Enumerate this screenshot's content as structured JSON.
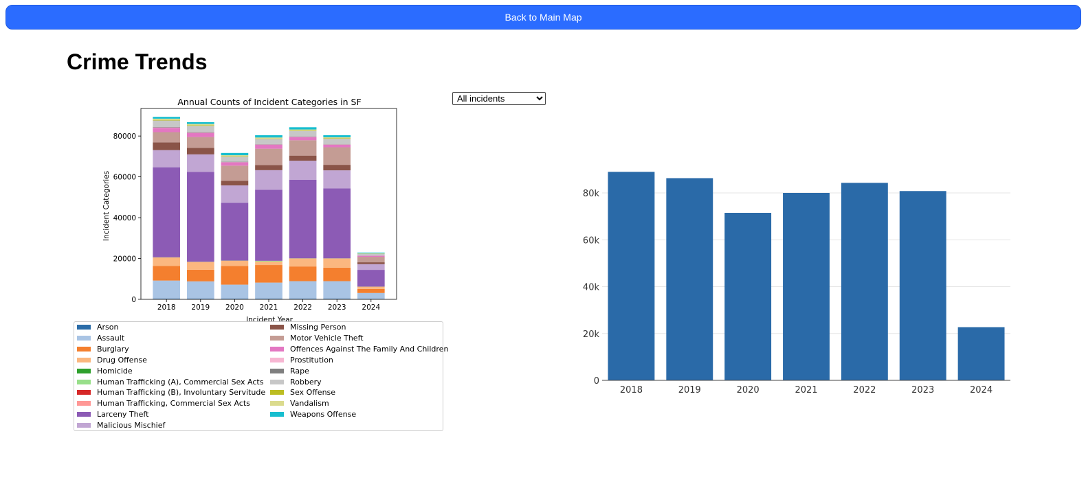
{
  "nav": {
    "back_label": "Back to Main Map"
  },
  "page": {
    "title": "Crime Trends"
  },
  "filter": {
    "selected": "All incidents",
    "options": [
      "All incidents"
    ]
  },
  "chart_data": [
    {
      "type": "bar",
      "stacked": true,
      "title": "Annual Counts of Incident Categories in SF",
      "xlabel": "Incident Year",
      "ylabel": "Incident Categories",
      "ylim": [
        0,
        93500
      ],
      "yticks": [
        0,
        20000,
        40000,
        60000,
        80000
      ],
      "grid": false,
      "legend_position": "below",
      "categories": [
        "2018",
        "2019",
        "2020",
        "2021",
        "2022",
        "2023",
        "2024"
      ],
      "series": [
        {
          "name": "Arson",
          "color": "#2b6ca8",
          "values": [
            300,
            300,
            300,
            300,
            300,
            300,
            100
          ]
        },
        {
          "name": "Assault",
          "color": "#a9c4e4",
          "values": [
            8900,
            8500,
            6900,
            7900,
            8600,
            8600,
            3000
          ]
        },
        {
          "name": "Burglary",
          "color": "#f47f2e",
          "values": [
            7200,
            5700,
            9100,
            8600,
            7200,
            6600,
            2000
          ]
        },
        {
          "name": "Drug Offense",
          "color": "#fbb77f",
          "values": [
            4100,
            3800,
            2600,
            1700,
            3900,
            4500,
            1100
          ]
        },
        {
          "name": "Homicide",
          "color": "#2ea02c",
          "values": [
            50,
            50,
            50,
            60,
            60,
            50,
            20
          ]
        },
        {
          "name": "Human Trafficking (A), Commercial Sex Acts",
          "color": "#98df8a",
          "values": [
            20,
            30,
            30,
            300,
            30,
            20,
            10
          ]
        },
        {
          "name": "Human Trafficking (B), Involuntary Servitude",
          "color": "#d62828",
          "values": [
            10,
            10,
            10,
            10,
            10,
            10,
            5
          ]
        },
        {
          "name": "Human Trafficking, Commercial Sex Acts",
          "color": "#ff9896",
          "values": [
            20,
            20,
            10,
            10,
            10,
            10,
            5
          ]
        },
        {
          "name": "Larceny Theft",
          "color": "#8c5bb5",
          "values": [
            44100,
            44000,
            28300,
            34800,
            38500,
            34300,
            8200
          ]
        },
        {
          "name": "Malicious Mischief",
          "color": "#c1a6d3",
          "values": [
            8400,
            8600,
            8500,
            9600,
            9300,
            8800,
            2800
          ]
        },
        {
          "name": "Missing Person",
          "color": "#8a5448",
          "values": [
            3800,
            3200,
            2300,
            2500,
            2500,
            2700,
            900
          ]
        },
        {
          "name": "Motor Vehicle Theft",
          "color": "#c49c94",
          "values": [
            5000,
            5300,
            7400,
            8000,
            7500,
            8600,
            2700
          ]
        },
        {
          "name": "Offences Against The Family And Children",
          "color": "#e377c2",
          "values": [
            2100,
            2000,
            1600,
            2000,
            1600,
            1200,
            500
          ]
        },
        {
          "name": "Prostitution",
          "color": "#f7b6d2",
          "values": [
            200,
            200,
            100,
            100,
            100,
            200,
            50
          ]
        },
        {
          "name": "Rape",
          "color": "#7f7f7f",
          "values": [
            300,
            300,
            200,
            200,
            200,
            200,
            80
          ]
        },
        {
          "name": "Robbery",
          "color": "#c7c7c7",
          "values": [
            3100,
            3000,
            2500,
            2500,
            2700,
            2600,
            800
          ]
        },
        {
          "name": "Sex Offense",
          "color": "#bcbd22",
          "values": [
            300,
            300,
            200,
            200,
            200,
            200,
            80
          ]
        },
        {
          "name": "Vandalism",
          "color": "#dbdb8d",
          "values": [
            600,
            600,
            500,
            500,
            500,
            500,
            150
          ]
        },
        {
          "name": "Weapons Offense",
          "color": "#17becf",
          "values": [
            900,
            900,
            1100,
            1100,
            1100,
            1000,
            400
          ]
        }
      ]
    },
    {
      "type": "bar",
      "title": "",
      "xlabel": "",
      "ylabel": "",
      "color": "#2a6aa8",
      "ylim": [
        0,
        93000
      ],
      "yticks": [
        0,
        20000,
        40000,
        60000,
        80000
      ],
      "ytick_labels": [
        "0",
        "20k",
        "40k",
        "60k",
        "80k"
      ],
      "grid": true,
      "categories": [
        "2018",
        "2019",
        "2020",
        "2021",
        "2022",
        "2023",
        "2024"
      ],
      "values": [
        89000,
        86300,
        71500,
        80000,
        84300,
        80800,
        22700
      ]
    }
  ]
}
